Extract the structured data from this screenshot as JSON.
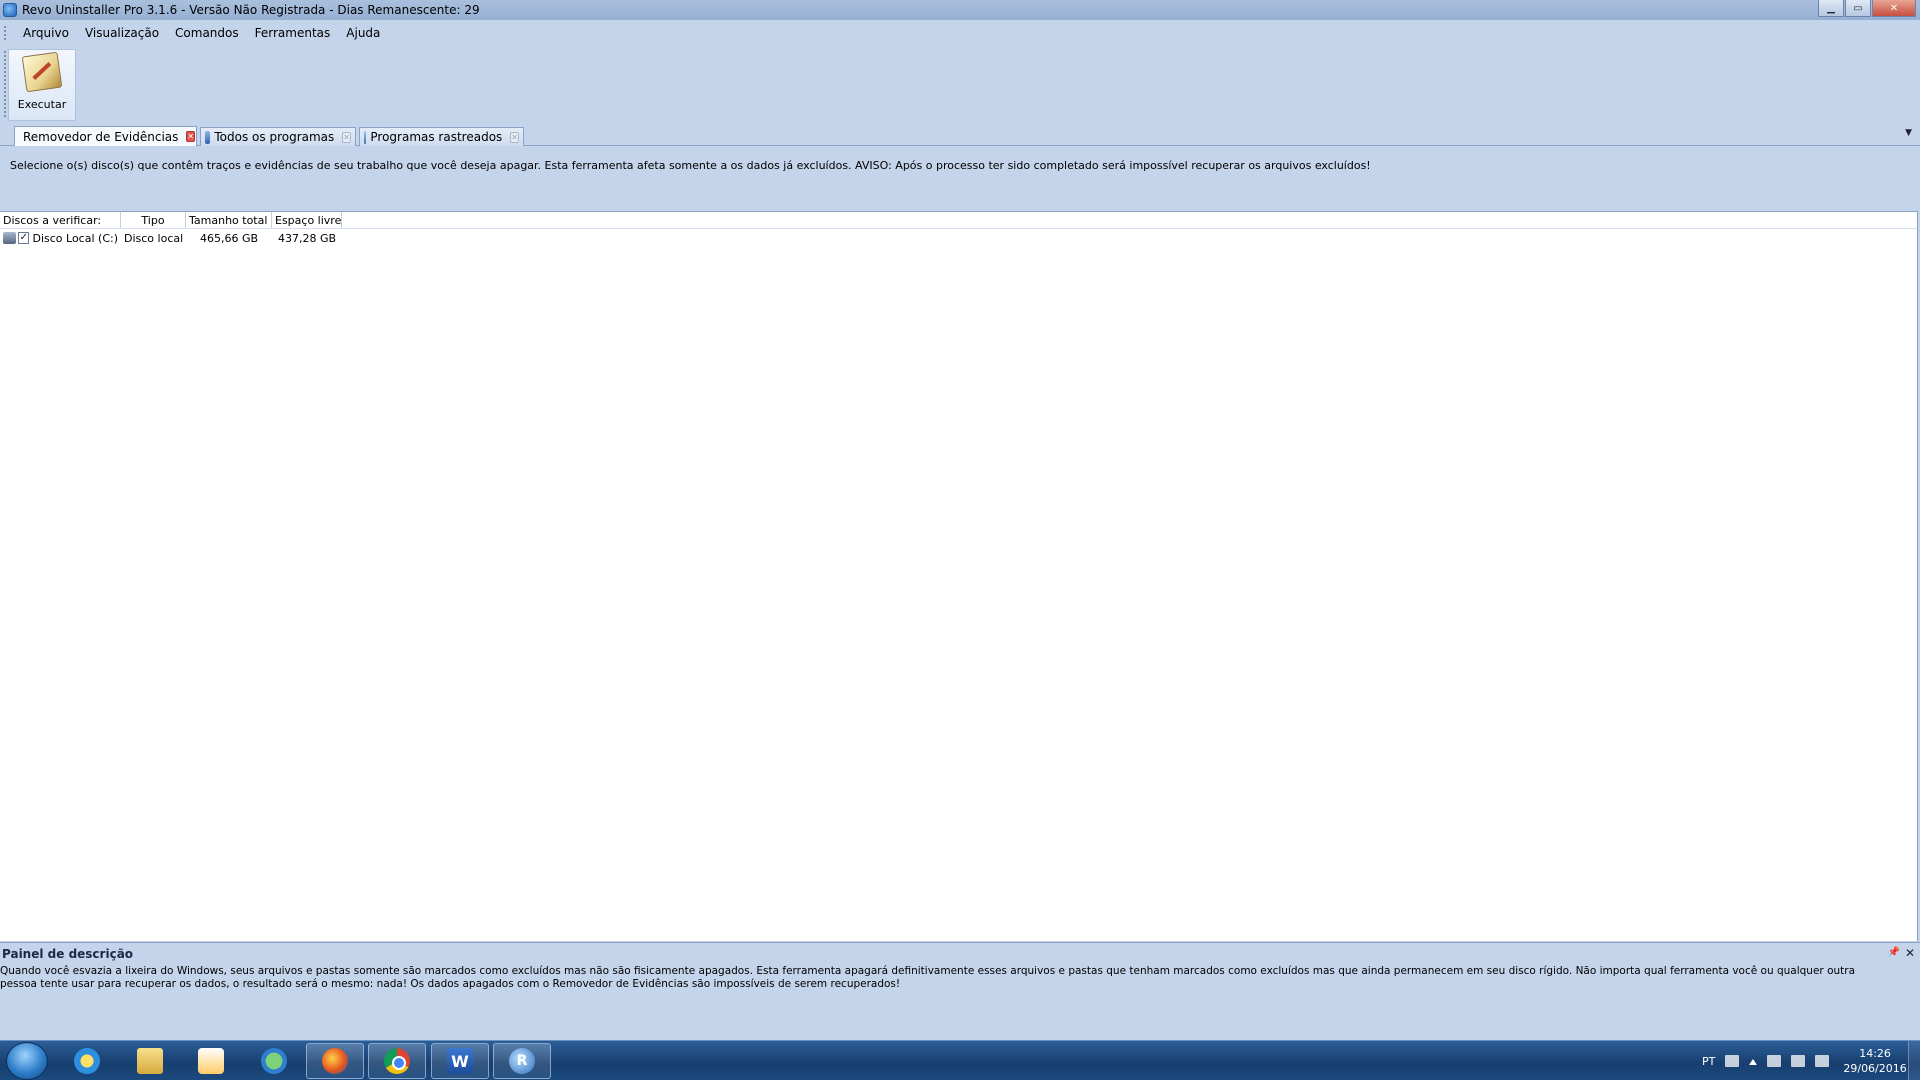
{
  "window": {
    "title": "Revo Uninstaller Pro 3.1.6 - Versão Não Registrada - Dias Remanescente: 29",
    "controls": {
      "minimize": "▁",
      "maximize": "▭",
      "close": "✕"
    }
  },
  "menubar": {
    "items": [
      "Arquivo",
      "Visualização",
      "Comandos",
      "Ferramentas",
      "Ajuda"
    ]
  },
  "toolbar": {
    "run_label": "Executar"
  },
  "tabs": [
    {
      "label": "Removedor de Evidências",
      "active": true
    },
    {
      "label": "Todos os programas",
      "active": false
    },
    {
      "label": "Programas rastreados",
      "active": false
    }
  ],
  "tab_close_glyph": "✕",
  "tab_menu_glyph": "▼",
  "info_message": "Selecione o(s) disco(s) que contêm traços e evidências de seu trabalho que você deseja apagar. Esta ferramenta afeta somente a os dados já excluídos. AVISO: Após o processo ter sido completado será impossível recuperar os arquivos excluídos!",
  "disk_list": {
    "columns": [
      "Discos a verificar:",
      "Tipo",
      "Tamanho total",
      "Espaço livre"
    ],
    "rows": [
      {
        "checked": "✓",
        "name": "Disco Local (C:)",
        "type": "Disco local",
        "total": "465,66 GB",
        "free": "437,28 GB"
      }
    ]
  },
  "description_panel": {
    "title": "Painel de descrição",
    "pin_glyph": "📌",
    "close_glyph": "✕",
    "text": "Quando você esvazia a lixeira do Windows, seus arquivos e pastas somente são marcados como excluídos mas não são fisicamente apagados. Esta ferramenta apagará definitivamente esses arquivos e pastas que tenham marcados como excluídos mas que ainda permanecem em seu disco rígido. Não importa qual ferramenta você ou qualquer outra pessoa tente usar para recuperar os dados, o resultado será o mesmo: nada! Os dados apagados com o Removedor de Evidências são impossíveis de serem recuperados!"
  },
  "taskbar": {
    "word_glyph": "W",
    "revo_glyph": "R",
    "language": "PT",
    "time": "14:26",
    "date": "29/06/2016"
  }
}
